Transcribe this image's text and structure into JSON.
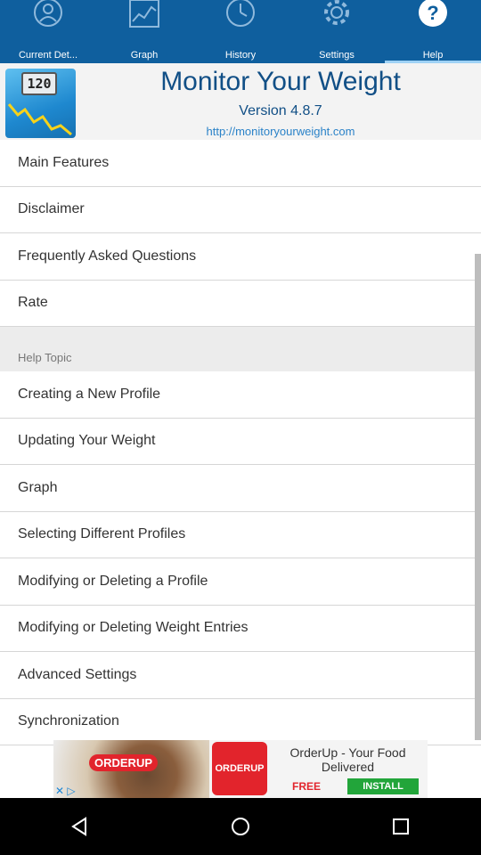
{
  "tabs": [
    {
      "label": "Current Det...",
      "icon": "person-icon",
      "active": false
    },
    {
      "label": "Graph",
      "icon": "graph-icon",
      "active": false
    },
    {
      "label": "History",
      "icon": "clock-icon",
      "active": false
    },
    {
      "label": "Settings",
      "icon": "gear-icon",
      "active": false
    },
    {
      "label": "Help",
      "icon": "help-icon",
      "active": true
    }
  ],
  "header": {
    "title": "Monitor Your Weight",
    "version": "Version 4.8.7",
    "url": "http://monitoryourweight.com",
    "logo_display": "120"
  },
  "main_items": [
    "Main Features",
    "Disclaimer",
    "Frequently Asked Questions",
    "Rate"
  ],
  "section_title": "Help Topic",
  "help_topics": [
    "Creating a New Profile",
    "Updating Your Weight",
    "Graph",
    "Selecting Different Profiles",
    "Modifying or Deleting a Profile",
    "Modifying or Deleting Weight Entries",
    "Advanced Settings",
    "Synchronization"
  ],
  "ad": {
    "brand": "ORDERUP",
    "logo_text": "ORDERUP",
    "headline": "OrderUp - Your Food Delivered",
    "free": "FREE",
    "install": "INSTALL"
  },
  "colors": {
    "tabbar": "#0f5f9e",
    "title": "#114f86",
    "link": "#2a82c8",
    "ad_red": "#e2242c",
    "install_green": "#22a53a"
  }
}
